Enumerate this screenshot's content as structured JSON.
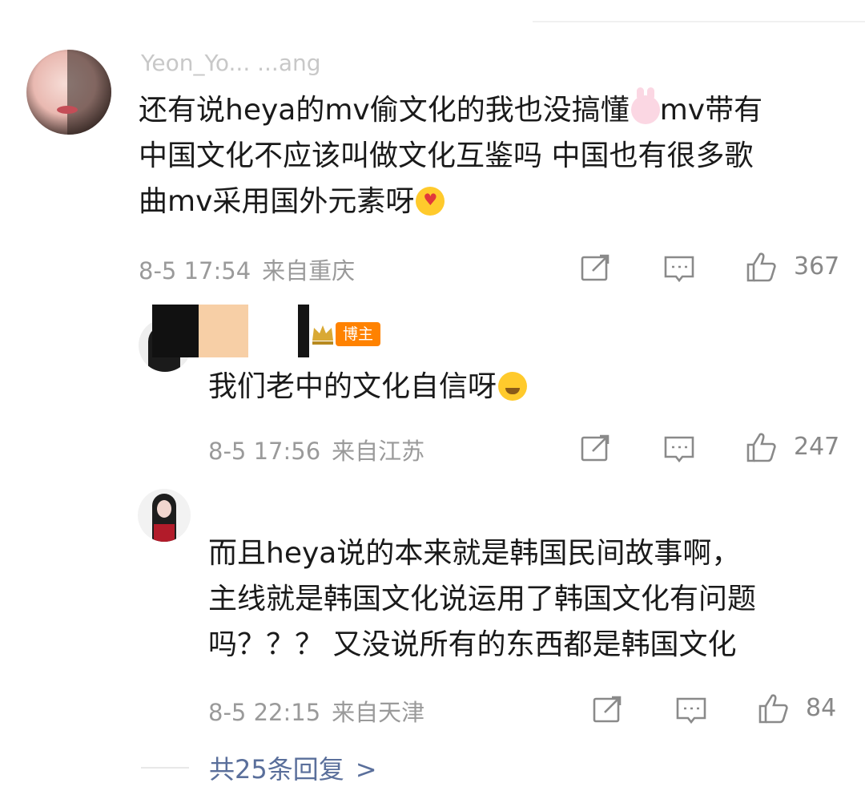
{
  "comments": [
    {
      "username": "Yeon_Yo... ...ang",
      "text_lines": [
        "还有说heya的mv偷文化的我也没搞懂",
        "mv带有",
        "中国文化不应该叫做文化互鉴吗 中国也有很多歌",
        "曲mv采用国外元素呀"
      ],
      "emoji": [
        "bunny-emoji",
        "heart-eyes-emoji"
      ],
      "date": "8-5 17:54",
      "location": "来自重庆",
      "likes": "367"
    },
    {
      "username": "",
      "badge": "博主",
      "text_lines": [
        "我们老中的文化自信呀"
      ],
      "emoji": [
        "crying-emoji"
      ],
      "date": "8-5 17:56",
      "location": "来自江苏",
      "likes": "247"
    },
    {
      "username": "",
      "text_lines": [
        "而且heya说的本来就是韩国民间故事啊，",
        "主线就是韩国文化说运用了韩国文化有问题",
        "吗？？？ 又没说所有的东西都是韩国文化"
      ],
      "date": "8-5 22:15",
      "location": "来自天津",
      "likes": "84"
    }
  ],
  "more_replies": "共25条回复",
  "more_chevron": ">",
  "icons": [
    "repost-icon",
    "comment-icon",
    "like-icon",
    "chevron-right-icon"
  ],
  "colors": {
    "badge": "#ff8200",
    "link": "#5a6f9b",
    "meta": "#9a9a9a"
  }
}
